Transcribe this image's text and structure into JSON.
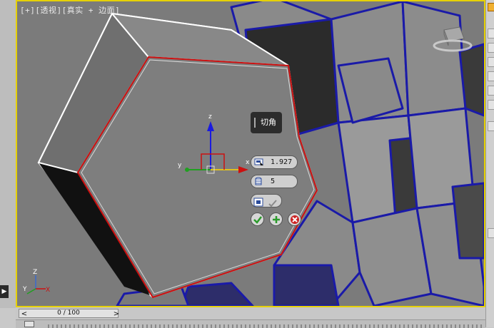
{
  "viewport": {
    "label": "[+][透视][真实 + 边面]"
  },
  "axes": {
    "gizmo_z": "z",
    "gizmo_x": "x",
    "gizmo_y": "y",
    "corner_z": "Z",
    "corner_y": "Y",
    "corner_x": "X"
  },
  "chamfer_caddy": {
    "title": "切角",
    "amount": "1.927",
    "segments": "5",
    "ok_icon": "check-icon",
    "apply_icon": "plus-icon",
    "cancel_icon": "close-icon"
  },
  "timeline": {
    "frame": "0 / 100",
    "prev": "<",
    "next": ">"
  },
  "colors": {
    "viewport_border": "#e6d100",
    "selected_edge": "#cc1010",
    "unselected_wire": "#1a1aa8",
    "ok_green": "#2a9a2a",
    "cancel_red": "#cc2222"
  }
}
